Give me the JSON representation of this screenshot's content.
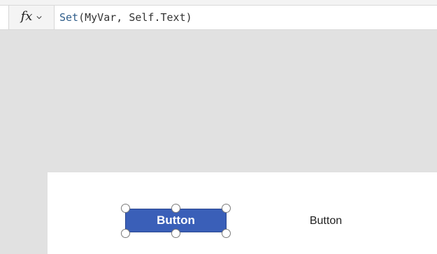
{
  "formula_bar": {
    "fx_label": "fx",
    "formula_function": "Set",
    "formula_args": "(MyVar, Self.Text)"
  },
  "canvas": {
    "button_label": "Button",
    "second_label": "Button"
  },
  "icons": {
    "dropdown": "chevron-down-icon"
  },
  "colors": {
    "button_fill": "#3a5fb8",
    "canvas_background": "#e1e1e1",
    "screen_background": "#ffffff",
    "formula_function": "#2f5d8a"
  }
}
